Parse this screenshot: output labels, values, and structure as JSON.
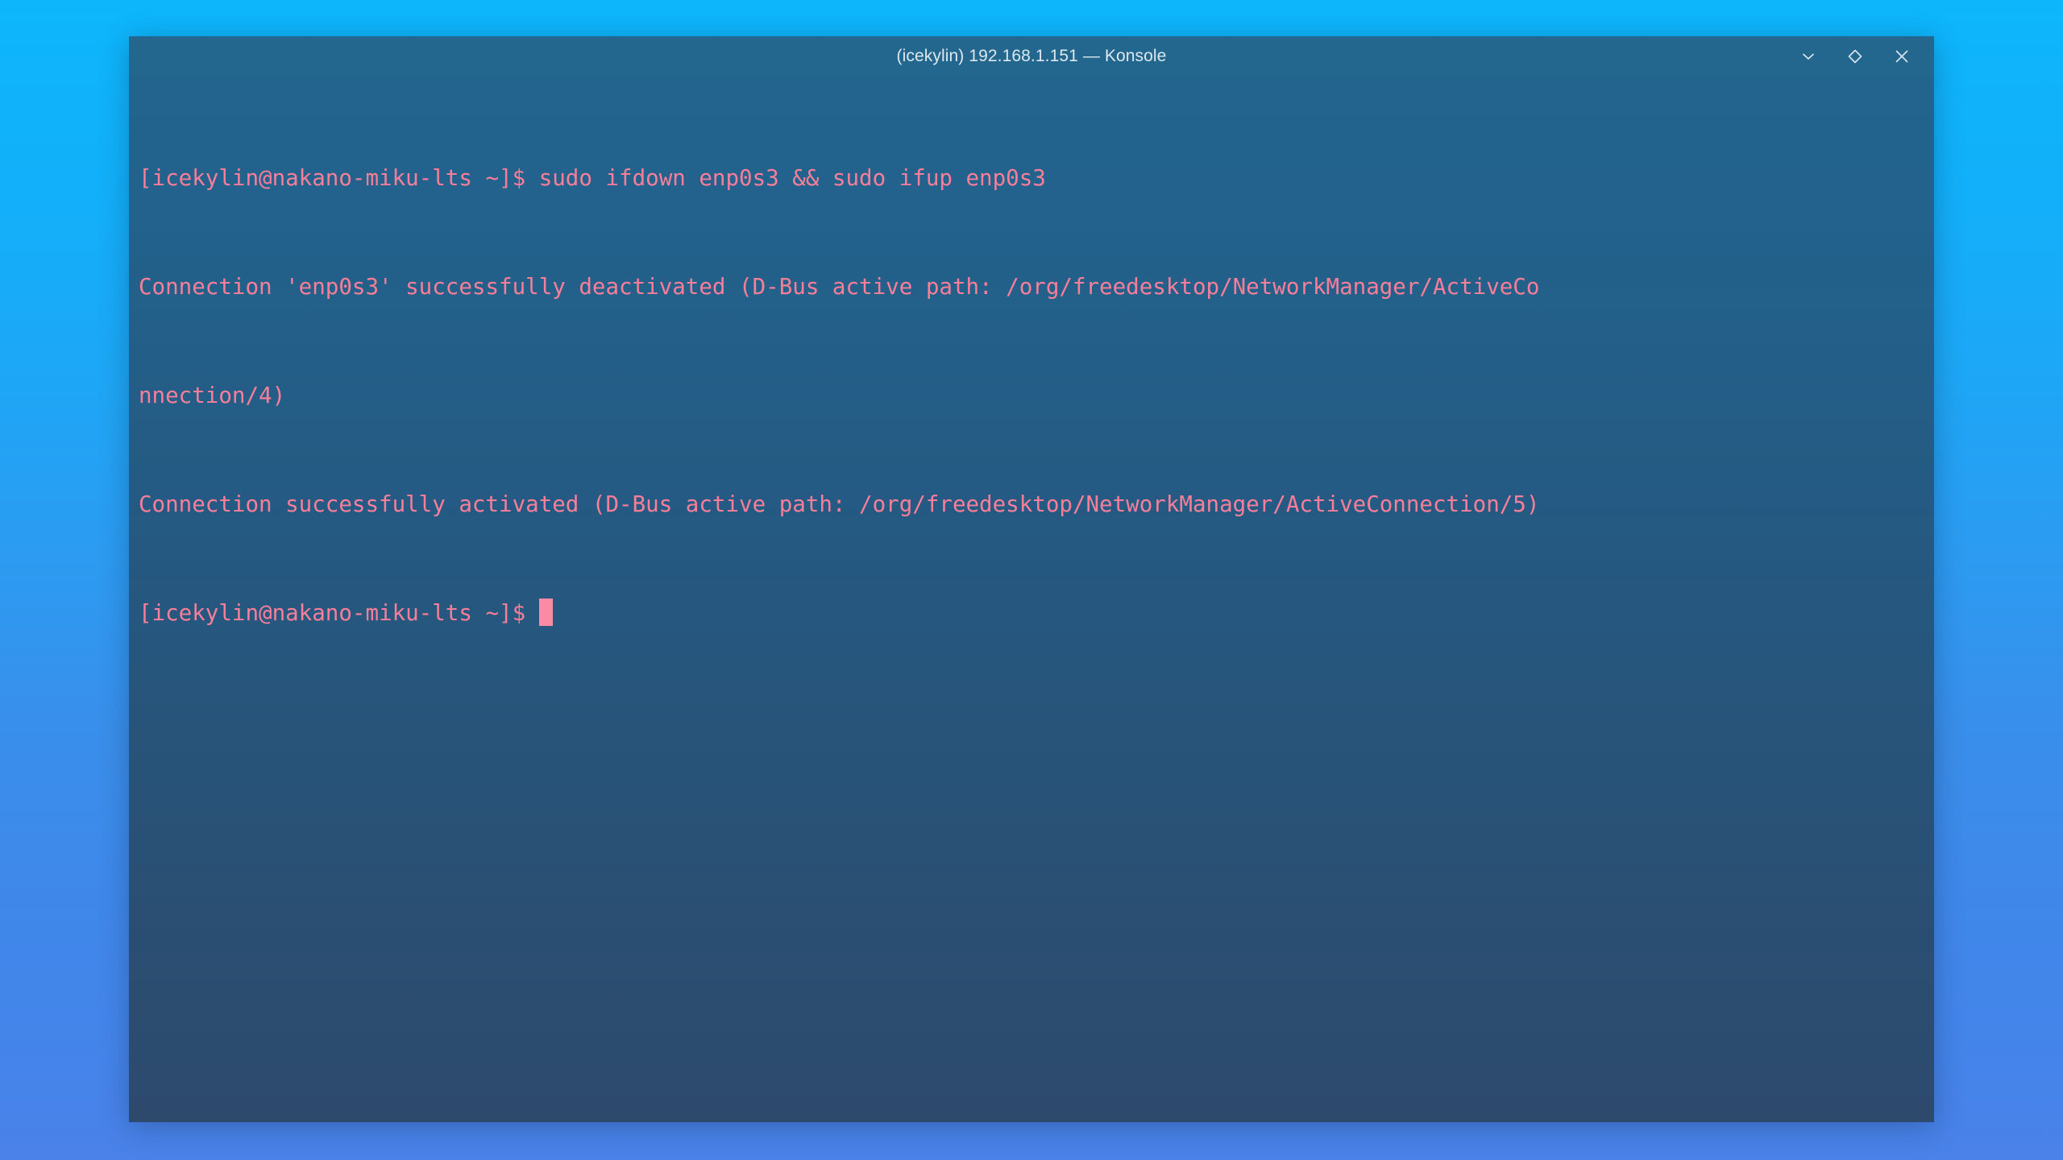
{
  "desktop": {
    "wallpaper_top_color": "#0db6fb",
    "wallpaper_bottom_color": "#4a82e9"
  },
  "window": {
    "app_name": "Konsole",
    "title": "(icekylin) 192.168.1.151 — Konsole",
    "titlebar_color": "#23678f",
    "controls": [
      {
        "name": "minimize",
        "glyph": "chevron-down"
      },
      {
        "name": "maximize",
        "glyph": "diamond"
      },
      {
        "name": "close",
        "glyph": "x"
      }
    ]
  },
  "terminal": {
    "background_top_color": "#22648e",
    "background_bottom_color": "#2d4a6d",
    "foreground_color": "#f97e99",
    "cursor_color": "#fb8aa4",
    "prompt": "[icekylin@nakano-miku-lts ~]$ ",
    "user": "icekylin",
    "host": "nakano-miku-lts",
    "cwd": "~",
    "lines": [
      "[icekylin@nakano-miku-lts ~]$ sudo ifdown enp0s3 && sudo ifup enp0s3",
      "Connection 'enp0s3' successfully deactivated (D-Bus active path: /org/freedesktop/NetworkManager/ActiveCo",
      "nnection/4)",
      "Connection successfully activated (D-Bus active path: /org/freedesktop/NetworkManager/ActiveConnection/5)"
    ],
    "current_prompt_line": "[icekylin@nakano-miku-lts ~]$ ",
    "command_entered": "sudo ifdown enp0s3 && sudo ifup enp0s3"
  }
}
